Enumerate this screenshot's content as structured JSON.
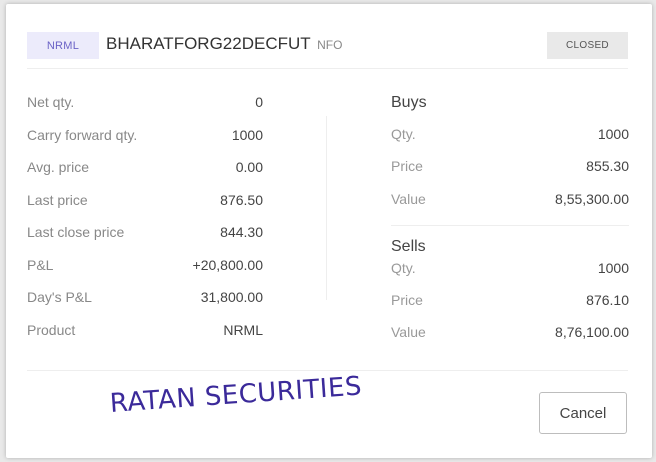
{
  "header": {
    "product_badge": "NRML",
    "symbol": "BHARATFORG22DECFUT",
    "exchange": "NFO",
    "status_badge": "CLOSED"
  },
  "position": [
    {
      "label": "Net qty.",
      "value": "0"
    },
    {
      "label": "Carry forward qty.",
      "value": "1000"
    },
    {
      "label": "Avg. price",
      "value": "0.00"
    },
    {
      "label": "Last price",
      "value": "876.50"
    },
    {
      "label": "Last close price",
      "value": "844.30"
    },
    {
      "label": "P&L",
      "value": "+20,800.00"
    },
    {
      "label": "Day's P&L",
      "value": "31,800.00"
    },
    {
      "label": "Product",
      "value": "NRML"
    }
  ],
  "buys": {
    "title": "Buys",
    "rows": [
      {
        "label": "Qty.",
        "value": "1000"
      },
      {
        "label": "Price",
        "value": "855.30"
      },
      {
        "label": "Value",
        "value": "8,55,300.00"
      }
    ]
  },
  "sells": {
    "title": "Sells",
    "rows": [
      {
        "label": "Qty.",
        "value": "1000"
      },
      {
        "label": "Price",
        "value": "876.10"
      },
      {
        "label": "Value",
        "value": "8,76,100.00"
      }
    ]
  },
  "watermark": "RATAN SECURITIES",
  "footer": {
    "cancel_label": "Cancel"
  },
  "colors": {
    "accent": "#6b63c6",
    "watermark": "#3b2a9a"
  }
}
